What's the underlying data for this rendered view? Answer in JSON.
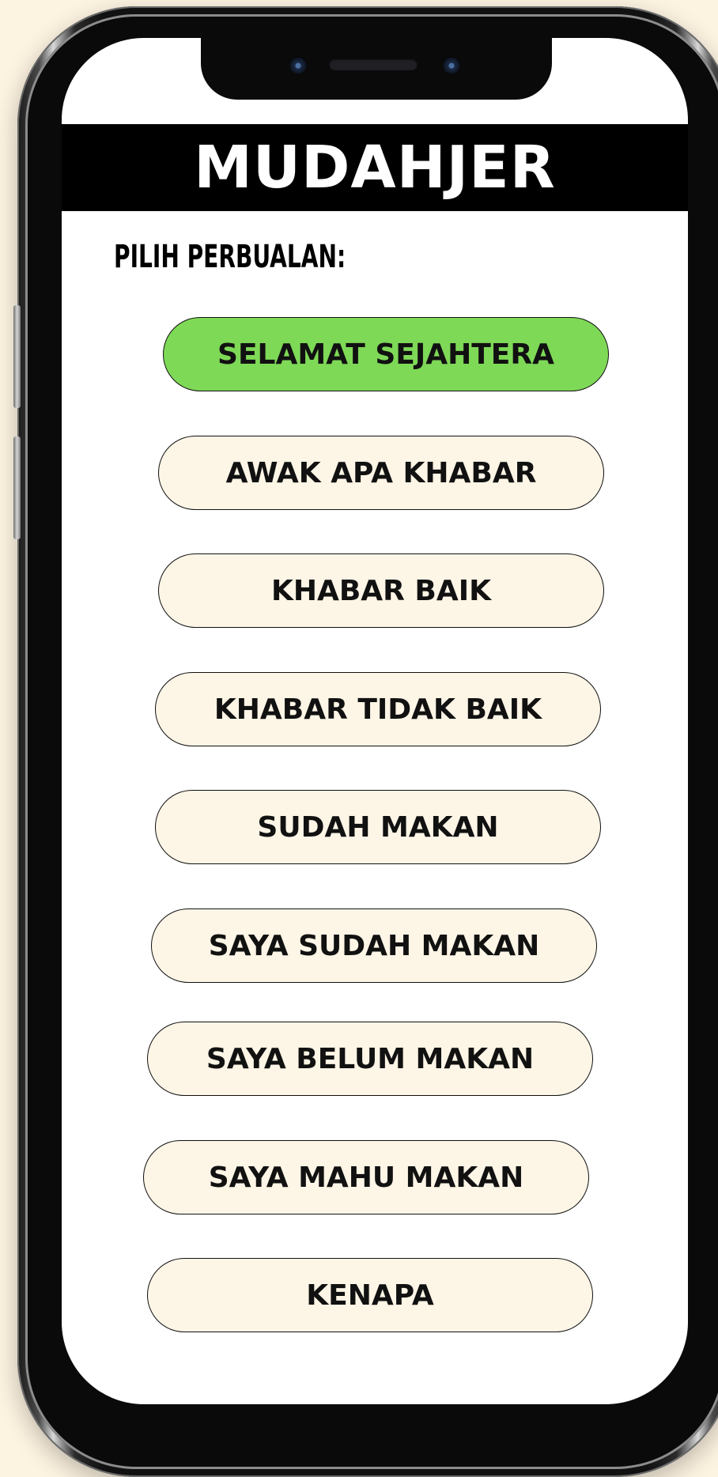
{
  "app": {
    "title": "MUDAHJER"
  },
  "main": {
    "prompt_label": "PILIH PERBUALAN:",
    "options": [
      {
        "label": "SELAMAT SEJAHTERA",
        "selected": true
      },
      {
        "label": "AWAK APA KHABAR",
        "selected": false
      },
      {
        "label": "KHABAR BAIK",
        "selected": false
      },
      {
        "label": "KHABAR TIDAK BAIK",
        "selected": false
      },
      {
        "label": "SUDAH MAKAN",
        "selected": false
      },
      {
        "label": "SAYA SUDAH MAKAN",
        "selected": false
      },
      {
        "label": "SAYA BELUM MAKAN",
        "selected": false
      },
      {
        "label": "SAYA MAHU MAKAN",
        "selected": false
      },
      {
        "label": "KENAPA",
        "selected": false
      }
    ]
  },
  "colors": {
    "selected_option": "#7ed957",
    "option_background": "#fdf5e6",
    "header_background": "#000000",
    "page_background": "#fdf3e1"
  }
}
